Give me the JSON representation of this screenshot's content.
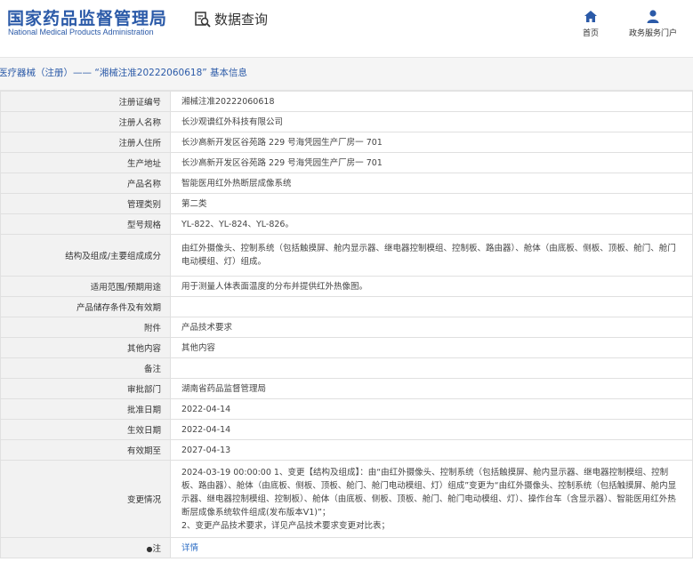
{
  "header": {
    "logo_cn": "国家药品监督管理局",
    "logo_en": "National Medical Products Administration",
    "query_label": "数据查询",
    "nav": [
      {
        "label": "首页",
        "icon": "home-icon"
      },
      {
        "label": "政务服务门户",
        "icon": "user-icon"
      }
    ]
  },
  "breadcrumb": "医疗器械（注册）—— “湘械注准20222060618” 基本信息",
  "colors": {
    "brand": "#2b5aa8",
    "label_bg": "#f2f2f2",
    "link": "#2b6cc4"
  },
  "rows": [
    {
      "label": "注册证编号",
      "value": "湘械注准20222060618"
    },
    {
      "label": "注册人名称",
      "value": "长沙观谱红外科技有限公司"
    },
    {
      "label": "注册人住所",
      "value": "长沙高新开发区谷苑路 229 号海凭园生产厂房一 701"
    },
    {
      "label": "生产地址",
      "value": "长沙高新开发区谷苑路 229 号海凭园生产厂房一 701"
    },
    {
      "label": "产品名称",
      "value": "智能医用红外热断层成像系统"
    },
    {
      "label": "管理类别",
      "value": "第二类"
    },
    {
      "label": "型号规格",
      "value": "YL-822、YL-824、YL-826。"
    },
    {
      "label": "结构及组成/主要组成成分",
      "value": "由红外摄像头、控制系统（包括触摸屏、舱内显示器、继电器控制模组、控制板、路由器）、舱体（由底板、侧板、顶板、舱门、舱门电动模组、灯）组成。"
    },
    {
      "label": "适用范围/预期用途",
      "value": "用于测量人体表面温度的分布并提供红外热像图。"
    },
    {
      "label": "产品储存条件及有效期",
      "value": ""
    },
    {
      "label": "附件",
      "value": "产品技术要求"
    },
    {
      "label": "其他内容",
      "value": "其他内容"
    },
    {
      "label": "备注",
      "value": ""
    },
    {
      "label": "审批部门",
      "value": "湖南省药品监督管理局"
    },
    {
      "label": "批准日期",
      "value": "2022-04-14"
    },
    {
      "label": "生效日期",
      "value": "2022-04-14"
    },
    {
      "label": "有效期至",
      "value": "2027-04-13"
    },
    {
      "label": "变更情况",
      "value": "2024-03-19 00:00:00 1、变更【结构及组成】：由“由红外摄像头、控制系统（包括触摸屏、舱内显示器、继电器控制模组、控制板、路由器）、舱体（由底板、侧板、顶板、舱门、舱门电动模组、灯）组成”变更为“由红外摄像头、控制系统（包括触摸屏、舱内显示器、继电器控制模组、控制板）、舱体（由底板、侧板、顶板、舱门、舱门电动模组、灯）、操作台车（含显示器）、智能医用红外热断层成像系统软件组成(发布版本V1)”；\n2、变更产品技术要求，详见产品技术要求变更对比表；"
    },
    {
      "label": "注",
      "value": "详情"
    }
  ]
}
